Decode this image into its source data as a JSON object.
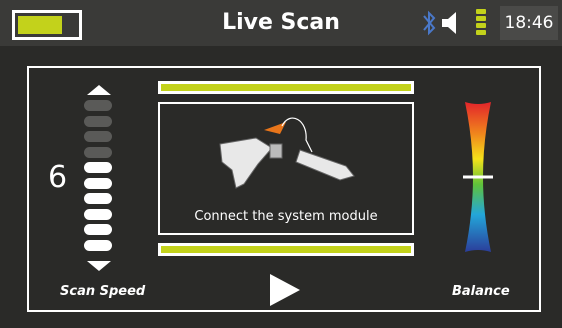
{
  "header": {
    "title": "Live Scan",
    "time": "18:46",
    "battery_level": 0.75
  },
  "icons": {
    "bluetooth": "bluetooth-icon",
    "volume": "speaker-icon",
    "signal": "signal-level-icon",
    "play": "play-icon",
    "module": "system-module-illustration"
  },
  "scan_speed": {
    "label": "Scan Speed",
    "value": "6",
    "level": 6,
    "max": 10
  },
  "module_prompt": {
    "message": "Connect the system module"
  },
  "balance": {
    "label": "Balance",
    "level": 0.5
  },
  "colors": {
    "accent": "#c3d21b",
    "background": "#2a2a28",
    "topbar": "#3a3a38"
  }
}
